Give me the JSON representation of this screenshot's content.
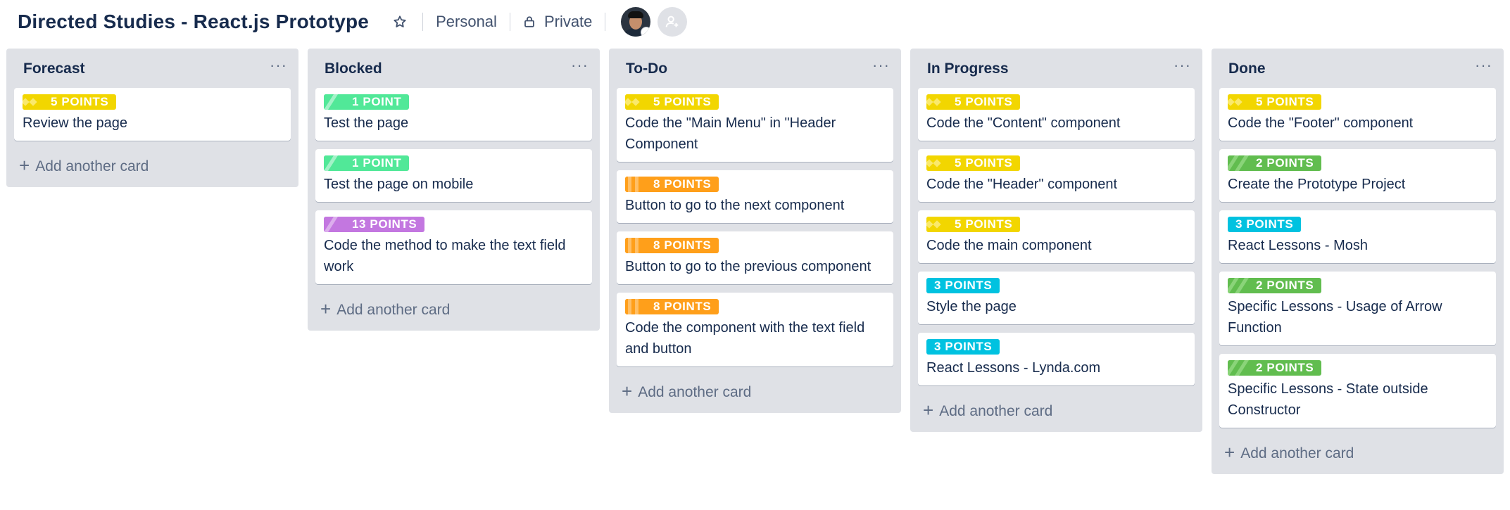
{
  "board": {
    "title": "Directed Studies - React.js Prototype",
    "team": "Personal",
    "visibility": "Private"
  },
  "colors": {
    "yellow": "#f2d600",
    "green": "#61bd4f",
    "lime": "#51e898",
    "orange": "#ff9f1a",
    "purple": "#c377e0",
    "sky": "#00c2e0"
  },
  "lists": [
    {
      "title": "Forecast",
      "menu": "···",
      "add_label": "Add another card",
      "cards": [
        {
          "label": "5 POINTS",
          "color": "yellow",
          "text": "Review the page"
        }
      ]
    },
    {
      "title": "Blocked",
      "menu": "···",
      "add_label": "Add another card",
      "cards": [
        {
          "label": "1 POINT",
          "color": "lime",
          "text": "Test the page"
        },
        {
          "label": "1 POINT",
          "color": "lime",
          "text": "Test the page on mobile"
        },
        {
          "label": "13 POINTS",
          "color": "purple",
          "text": "Code the method to make the text field work"
        }
      ]
    },
    {
      "title": "To-Do",
      "menu": "···",
      "add_label": "Add another card",
      "cards": [
        {
          "label": "5 POINTS",
          "color": "yellow",
          "text": "Code the \"Main Menu\" in \"Header Component"
        },
        {
          "label": "8 POINTS",
          "color": "orange",
          "text": "Button to go to the next component"
        },
        {
          "label": "8 POINTS",
          "color": "orange",
          "text": "Button to go to the previous component"
        },
        {
          "label": "8 POINTS",
          "color": "orange",
          "text": "Code the component with the text field and button"
        }
      ]
    },
    {
      "title": "In Progress",
      "menu": "···",
      "add_label": "Add another card",
      "cards": [
        {
          "label": "5 POINTS",
          "color": "yellow",
          "text": "Code the \"Content\" component"
        },
        {
          "label": "5 POINTS",
          "color": "yellow",
          "text": "Code the \"Header\" component"
        },
        {
          "label": "5 POINTS",
          "color": "yellow",
          "text": "Code the main component"
        },
        {
          "label": "3 POINTS",
          "color": "sky",
          "text": "Style the page"
        },
        {
          "label": "3 POINTS",
          "color": "sky",
          "text": "React Lessons - Lynda.com"
        }
      ]
    },
    {
      "title": "Done",
      "menu": "···",
      "add_label": "Add another card",
      "cards": [
        {
          "label": "5 POINTS",
          "color": "yellow",
          "text": "Code the \"Footer\" component"
        },
        {
          "label": "2 POINTS",
          "color": "green",
          "text": "Create the Prototype Project"
        },
        {
          "label": "3 POINTS",
          "color": "sky",
          "text": "React Lessons - Mosh"
        },
        {
          "label": "2 POINTS",
          "color": "green",
          "text": "Specific Lessons - Usage of Arrow Function"
        },
        {
          "label": "2 POINTS",
          "color": "green",
          "text": "Specific Lessons - State outside Constructor"
        }
      ]
    }
  ]
}
